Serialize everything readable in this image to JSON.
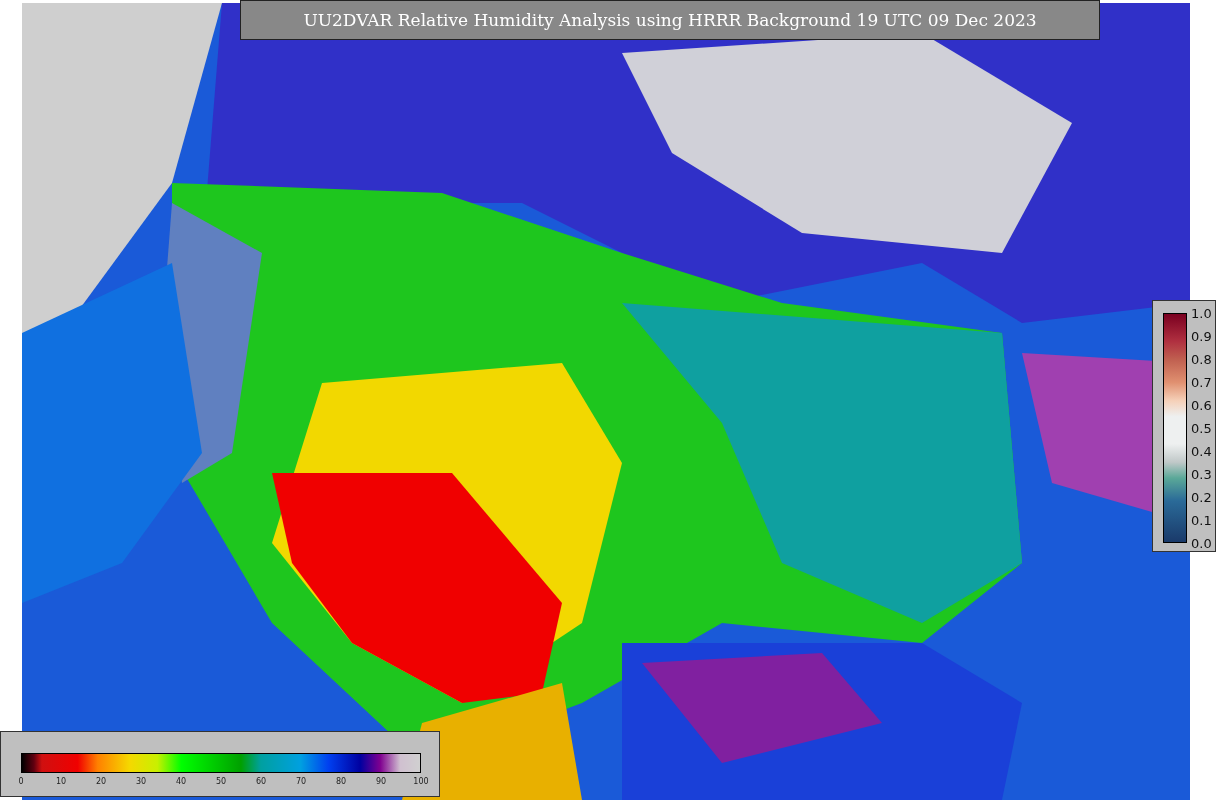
{
  "title": "UU2DVAR Relative Humidity Analysis using HRRR Background 19 UTC 09 Dec 2023",
  "humidity_colorbar": {
    "ticks": [
      "0",
      "10",
      "20",
      "30",
      "40",
      "50",
      "60",
      "70",
      "80",
      "90",
      "100"
    ]
  },
  "observation_colorbar": {
    "ticks": [
      "1.0",
      "0.9",
      "0.8",
      "0.7",
      "0.6",
      "0.5",
      "0.4",
      "0.3",
      "0.2",
      "0.1",
      "0.0"
    ]
  }
}
